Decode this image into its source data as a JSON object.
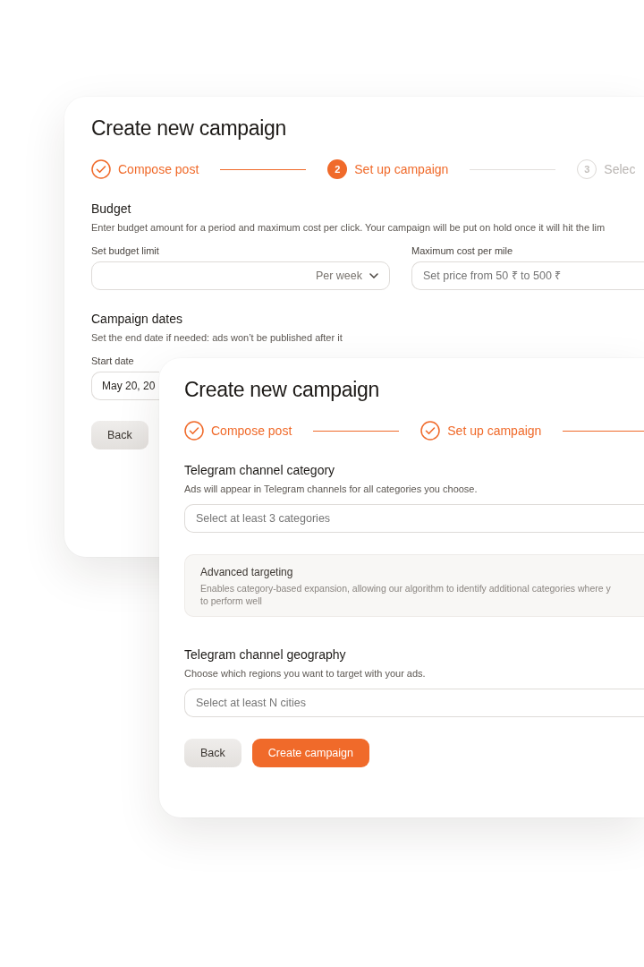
{
  "back_card": {
    "title": "Create new campaign",
    "steps": [
      {
        "label": "Compose post",
        "completed": true,
        "selected": false
      },
      {
        "number": "2",
        "label": "Set up campaign",
        "completed": false,
        "selected": true
      },
      {
        "number": "3",
        "label": "Selec",
        "completed": false,
        "selected": false
      }
    ],
    "budget": {
      "heading": "Budget",
      "description": "Enter budget amount for a period and maximum cost per click. Your campaign will be put on hold once it will hit the lim",
      "budget_limit": {
        "label": "Set budget limit",
        "period": "Per week"
      },
      "max_cost": {
        "label": "Maximum cost per mile",
        "placeholder": "Set price from 50 ₹ to 500 ₹"
      }
    },
    "dates": {
      "heading": "Campaign dates",
      "description": "Set the end date if needed: ads won’t be published after it",
      "start_date": {
        "label": "Start date",
        "value": "May 20, 20"
      }
    },
    "back_button": "Back"
  },
  "front_card": {
    "title": "Create new campaign",
    "steps": [
      {
        "label": "Compose post",
        "completed": true,
        "selected": false
      },
      {
        "label": "Set up campaign",
        "completed": true,
        "selected": false
      }
    ],
    "category": {
      "heading": "Telegram channel category",
      "description": "Ads will appear in Telegram channels for all categories you choose.",
      "placeholder": "Select at least 3 categories"
    },
    "advanced_targeting": {
      "title": "Advanced targeting",
      "description": [
        "Enables category-based expansion, allowing our algorithm to identify additional categories where y",
        "to perform well"
      ]
    },
    "geography": {
      "heading": "Telegram channel geography",
      "description": "Choose which regions you want to target with your ads.",
      "placeholder": "Select at least N cities"
    },
    "buttons": [
      {
        "label": "Back",
        "kind": "secondary"
      },
      {
        "label": "Create campaign",
        "kind": "primary"
      }
    ]
  }
}
